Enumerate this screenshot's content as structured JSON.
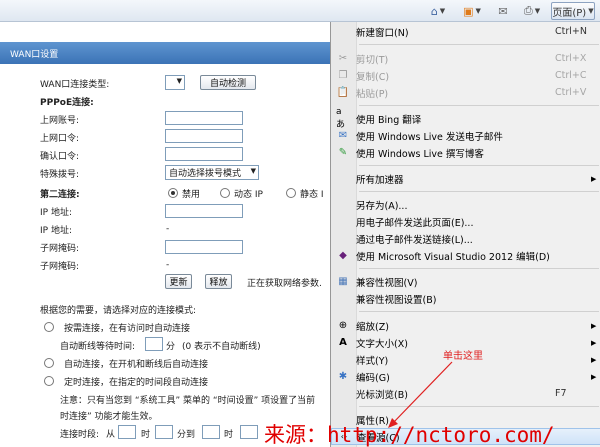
{
  "toolbar": {
    "page_label": "页面(P)",
    "icons": [
      "home-icon",
      "rss-icon",
      "mail-icon",
      "print-icon"
    ]
  },
  "router": {
    "section_title": "WAN口设置",
    "conn_type_label": "WAN口连接类型:",
    "auto_detect_label": "自动检测",
    "pppoe_label": "PPPoE连接:",
    "account_label": "上网账号:",
    "password_label": "上网口令:",
    "confirm_label": "确认口令:",
    "special_dial_label": "特殊拨号:",
    "special_dial_value": "自动选择拨号模式",
    "second_conn_label": "第二连接:",
    "second_conn_options": [
      "禁用",
      "动态 IP",
      "静态 I"
    ],
    "ip_label": "IP 地址:",
    "ip_label2": "IP 地址:",
    "ip_dash": "-",
    "mask_label": "子网掩码:",
    "mask_label2": "子网掩码:",
    "mask_dash": "-",
    "refresh_label": "更新",
    "release_label": "释放",
    "status_text": "正在获取网络参数.",
    "mode_prompt": "根据您的需要，请选择对应的连接模式:",
    "mode_demand": "按需连接，在有访问时自动连接",
    "idle_label": "自动断线等待时间:",
    "idle_unit": "分",
    "idle_hint": "(0 表示不自动断线)",
    "mode_auto": "自动连接，在开机和断线后自动连接",
    "mode_timed": "定时连接，在指定的时间段自动连接",
    "note_line1": "注意：只有当您到 “系统工具” 菜单的 “时间设置” 项设置了当前",
    "note_line2": "时连接” 功能才能生效。",
    "period_label": "连接时段:",
    "period_from": "从",
    "period_hour": "时",
    "period_minute_to": "分到",
    "period_hour2": "时"
  },
  "menu": {
    "items": [
      {
        "label": "新建窗口(N)",
        "shortcut": "Ctrl+N"
      },
      {
        "label": "剪切(T)",
        "shortcut": "Ctrl+X"
      },
      {
        "label": "复制(C)",
        "shortcut": "Ctrl+C"
      },
      {
        "label": "粘贴(P)",
        "shortcut": "Ctrl+V"
      },
      {
        "label": "使用 Bing 翻译"
      },
      {
        "label": "使用 Windows Live 发送电子邮件"
      },
      {
        "label": "使用 Windows Live 撰写博客"
      },
      {
        "label": "所有加速器"
      },
      {
        "label": "另存为(A)..."
      },
      {
        "label": "用电子邮件发送此页面(E)..."
      },
      {
        "label": "通过电子邮件发送链接(L)..."
      },
      {
        "label": "使用 Microsoft Visual Studio 2012 编辑(D)"
      },
      {
        "label": "兼容性视图(V)"
      },
      {
        "label": "兼容性视图设置(B)"
      },
      {
        "label": "缩放(Z)"
      },
      {
        "label": "文字大小(X)"
      },
      {
        "label": "样式(Y)"
      },
      {
        "label": "编码(G)"
      },
      {
        "label": "光标浏览(B)",
        "shortcut": "F7"
      },
      {
        "label": "属性(R)"
      },
      {
        "label": "查看源(C)"
      }
    ]
  },
  "annotation": "单击这里",
  "watermark": "来源：http://nctoro.com/"
}
